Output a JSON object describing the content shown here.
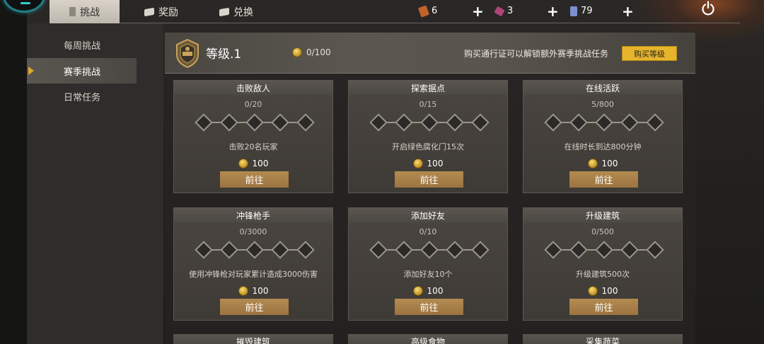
{
  "topbar": {
    "tabs": [
      {
        "label": "挑战",
        "icon": "book-icon",
        "active": true
      },
      {
        "label": "奖励",
        "icon": "box-icon",
        "active": false
      },
      {
        "label": "兑换",
        "icon": "box-icon",
        "active": false
      }
    ],
    "resources": [
      {
        "icon": "ticket-icon",
        "value": "6",
        "color": "#c0632a"
      },
      {
        "icon": "card-icon",
        "value": "3",
        "color": "#b0457a"
      },
      {
        "icon": "phone-icon",
        "value": "79",
        "color": "#7d8fd0"
      }
    ]
  },
  "sidenav": {
    "items": [
      {
        "label": "每周挑战",
        "active": false
      },
      {
        "label": "赛季挑战",
        "active": true
      },
      {
        "label": "日常任务",
        "active": false
      }
    ]
  },
  "header": {
    "level": "等级.1",
    "xp": "0/100",
    "notice": "购买通行证可以解锁额外赛季挑战任务",
    "buy_label": "购买等级"
  },
  "cards": [
    {
      "title": "击败敌人",
      "progress": "0/20",
      "desc": "击败20名玩家",
      "reward": "100",
      "button": "前往"
    },
    {
      "title": "探索据点",
      "progress": "0/15",
      "desc": "开启绿色腐化门15次",
      "reward": "100",
      "button": "前往"
    },
    {
      "title": "在线活跃",
      "progress": "5/800",
      "desc": "在线时长到达800分钟",
      "reward": "100",
      "button": "前往"
    },
    {
      "title": "冲锋枪手",
      "progress": "0/3000",
      "desc": "使用冲锋枪对玩家累计造成3000伤害",
      "reward": "100",
      "button": "前往"
    },
    {
      "title": "添加好友",
      "progress": "0/10",
      "desc": "添加好友10个",
      "reward": "100",
      "button": "前往"
    },
    {
      "title": "升级建筑",
      "progress": "0/500",
      "desc": "升级建筑500次",
      "reward": "100",
      "button": "前往"
    }
  ],
  "partial_cards": [
    "摧毁建筑",
    "高级食物",
    "采集蔬菜"
  ],
  "colors": {
    "accent": "#e6b52c",
    "button": "#a57c45"
  }
}
